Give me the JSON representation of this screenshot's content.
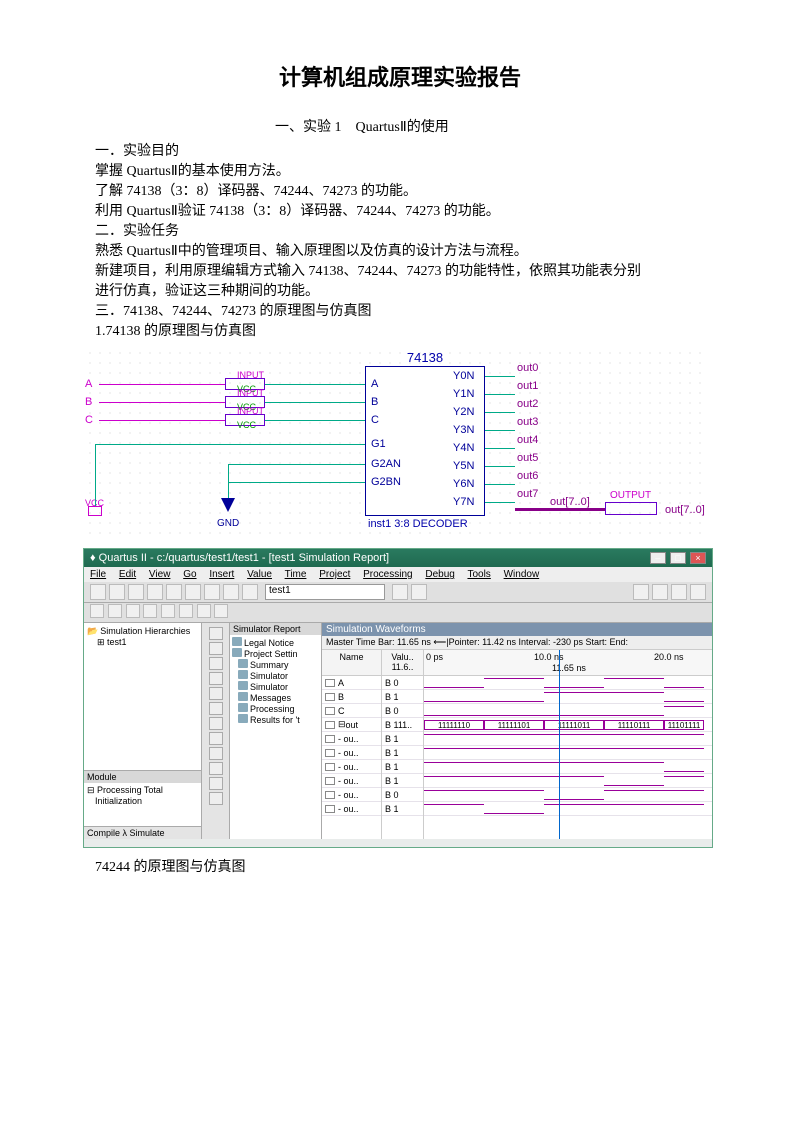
{
  "title": "计算机组成原理实验报告",
  "section_header": "一、实验 1　QuartusⅡ的使用",
  "body": {
    "p1": "一．实验目的",
    "p2": "掌握 QuartusⅡ的基本使用方法。",
    "p3": "了解 74138（3：8）译码器、74244、74273 的功能。",
    "p4": "利用 QuartusⅡ验证 74138（3：8）译码器、74244、74273 的功能。",
    "p5": "二．实验任务",
    "p6": "熟悉 QuartusⅡ中的管理项目、输入原理图以及仿真的设计方法与流程。",
    "p7": "新建项目，利用原理编辑方式输入 74138、74244、74273 的功能特性，依照其功能表分别",
    "p8": "进行仿真，验证这三种期间的功能。",
    "p9": "三．74138、74244、74273 的原理图与仿真图",
    "p10": "1.74138 的原理图与仿真图"
  },
  "schematic": {
    "chip_name": "74138",
    "chip_footer": "inst1  3:8 DECODER",
    "inputs": {
      "a": "A",
      "b": "B",
      "c": "C"
    },
    "input_tag": "INPUT",
    "vcc_tag": "VCC",
    "gnd_tag": "GND",
    "left_pins": [
      "A",
      "B",
      "C",
      "G1",
      "G2AN",
      "G2BN"
    ],
    "right_pins": [
      "Y0N",
      "Y1N",
      "Y2N",
      "Y3N",
      "Y4N",
      "Y5N",
      "Y6N",
      "Y7N"
    ],
    "wire_labels": [
      "out0",
      "out1",
      "out2",
      "out3",
      "out4",
      "out5",
      "out6",
      "out7"
    ],
    "output_label": "OUTPUT",
    "bus_label": "out[7..0]"
  },
  "quartus": {
    "title": "Quartus II - c:/quartus/test1/test1 - [test1 Simulation Report]",
    "menu": [
      "File",
      "Edit",
      "View",
      "Go",
      "Insert",
      "Value",
      "Time",
      "Project",
      "Processing",
      "Debug",
      "Tools",
      "Window"
    ],
    "combo_value": "test1",
    "hierarchy_title": "Simulation Hierarchies",
    "hierarchy_item": "test1",
    "module_title": "Module",
    "module_row1": "Processing Total",
    "module_row2": "Initialization",
    "tabs": "Compile λ Simulate",
    "tree_header": "Simulator Report",
    "tree_items": [
      "Legal Notice",
      "Project Settin",
      "Summary",
      "Simulator",
      "Simulator",
      "Messages",
      "Processing",
      "Results for 't"
    ],
    "wave_header": "Simulation Waveforms",
    "wave_bar": "Master Time Bar:  11.65 ns  ⟵|Pointer:  11.42 ns  Interval:  -230 ps  Start:       End:",
    "name_header": "Name",
    "value_header": "Valu.. 11.6..",
    "time_left": "0 ps",
    "time_mid": "10.0 ns",
    "time_right": "20.0 ns",
    "time_cursor": "11.65 ns",
    "signals": [
      {
        "name": "A",
        "val": "B 0"
      },
      {
        "name": "B",
        "val": "B 1"
      },
      {
        "name": "C",
        "val": "B 0"
      },
      {
        "name": "out",
        "val": "B 111..",
        "bus": true
      },
      {
        "name": "- ou..",
        "val": "B 1"
      },
      {
        "name": "- ou..",
        "val": "B 1"
      },
      {
        "name": "- ou..",
        "val": "B 1"
      },
      {
        "name": "- ou..",
        "val": "B 1"
      },
      {
        "name": "- ou..",
        "val": "B 0"
      },
      {
        "name": "- ou..",
        "val": "B 1"
      }
    ],
    "bus_vals": [
      "11111110",
      "11111101",
      "11111011",
      "11110111",
      "11101111"
    ]
  },
  "caption2": "74244 的原理图与仿真图"
}
